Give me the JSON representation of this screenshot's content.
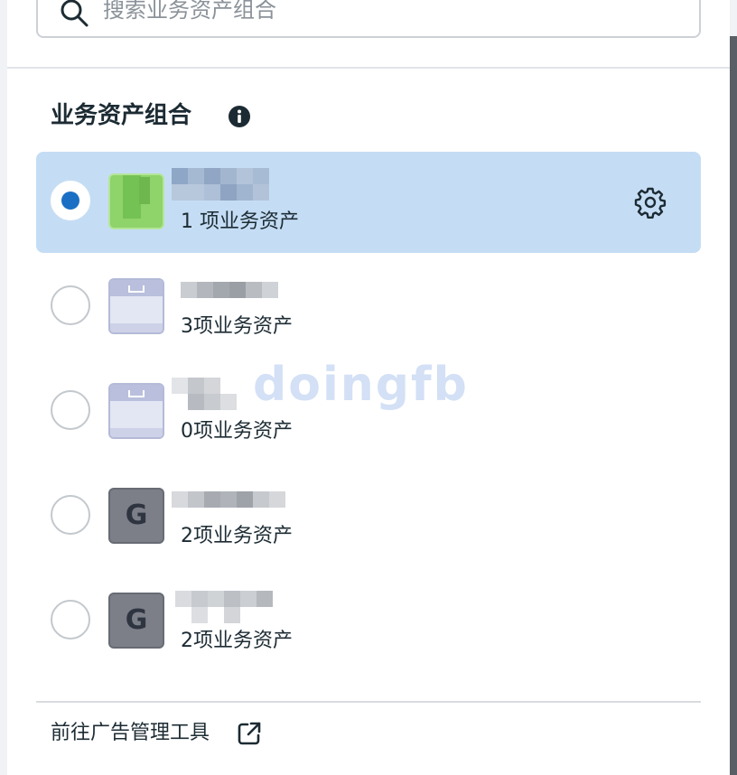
{
  "search": {
    "placeholder": "搜索业务资产组合"
  },
  "section": {
    "title": "业务资产组合"
  },
  "portfolios": [
    {
      "count_label": "1 项业务资产",
      "selected": true,
      "avatar": "green",
      "has_settings": true
    },
    {
      "count_label": "3项业务资产",
      "selected": false,
      "avatar": "briefcase"
    },
    {
      "count_label": "0项业务资产",
      "selected": false,
      "avatar": "briefcase"
    },
    {
      "count_label": "2项业务资产",
      "selected": false,
      "avatar": "letter",
      "avatar_letter": "G"
    },
    {
      "count_label": "2项业务资产",
      "selected": false,
      "avatar": "letter",
      "avatar_letter": "G"
    }
  ],
  "footer": {
    "link_label": "前往广告管理工具"
  },
  "watermark": "doingfb",
  "colors": {
    "selected_bg": "#c5ddf4",
    "radio_on": "#1a6fc4",
    "text": "#1c2b33"
  },
  "icons": [
    "search-icon",
    "info-icon",
    "gear-icon",
    "external-link-icon",
    "briefcase-icon"
  ]
}
